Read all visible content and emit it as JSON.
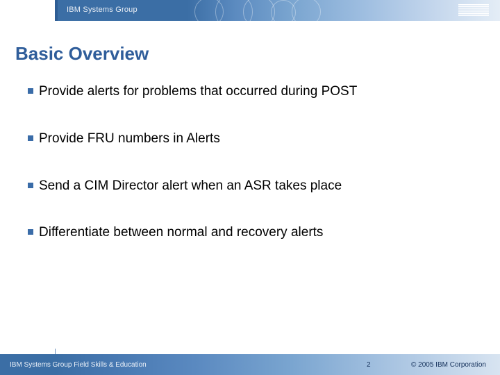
{
  "header": {
    "group_label": "IBM Systems Group",
    "logo_alt": "IBM"
  },
  "title": "Basic Overview",
  "bullets": [
    "Provide alerts for problems that occurred during POST",
    "Provide FRU numbers in Alerts",
    "Send a CIM Director alert when an ASR takes place",
    "Differentiate between normal and recovery alerts"
  ],
  "footer": {
    "left": "IBM Systems Group Field Skills & Education",
    "page": "2",
    "right": "© 2005 IBM Corporation"
  }
}
